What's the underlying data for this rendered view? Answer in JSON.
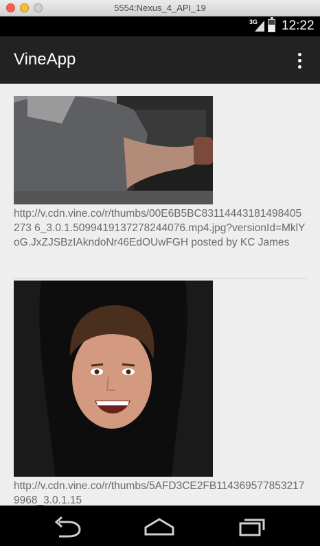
{
  "window": {
    "title": "5554:Nexus_4_API_19"
  },
  "status_bar": {
    "network": "3G",
    "time": "12:22"
  },
  "action_bar": {
    "title": "VineApp",
    "overflow_icon": "more-vert-icon"
  },
  "feed": {
    "items": [
      {
        "thumbnail_icon": "video-thumbnail",
        "caption": "http://v.cdn.vine.co/r/thumbs/00E6B5BC83114443181498405273 6_3.0.1.5099419137278244076.mp4.jpg?versionId=MklYoG.JxZJSBzIAkndoNr46EdOUwFGH posted by KC James"
      },
      {
        "thumbnail_icon": "video-thumbnail",
        "caption": "http://v.cdn.vine.co/r/thumbs/5AFD3CE2FB1143695778532179968_3.0.1.15"
      }
    ]
  },
  "nav_bar": {
    "back_icon": "back-icon",
    "home_icon": "home-icon",
    "recents_icon": "recents-icon"
  },
  "colors": {
    "action_bar": "#222222",
    "content_bg": "#eeeeee",
    "caption_text": "#6a6a6a"
  }
}
